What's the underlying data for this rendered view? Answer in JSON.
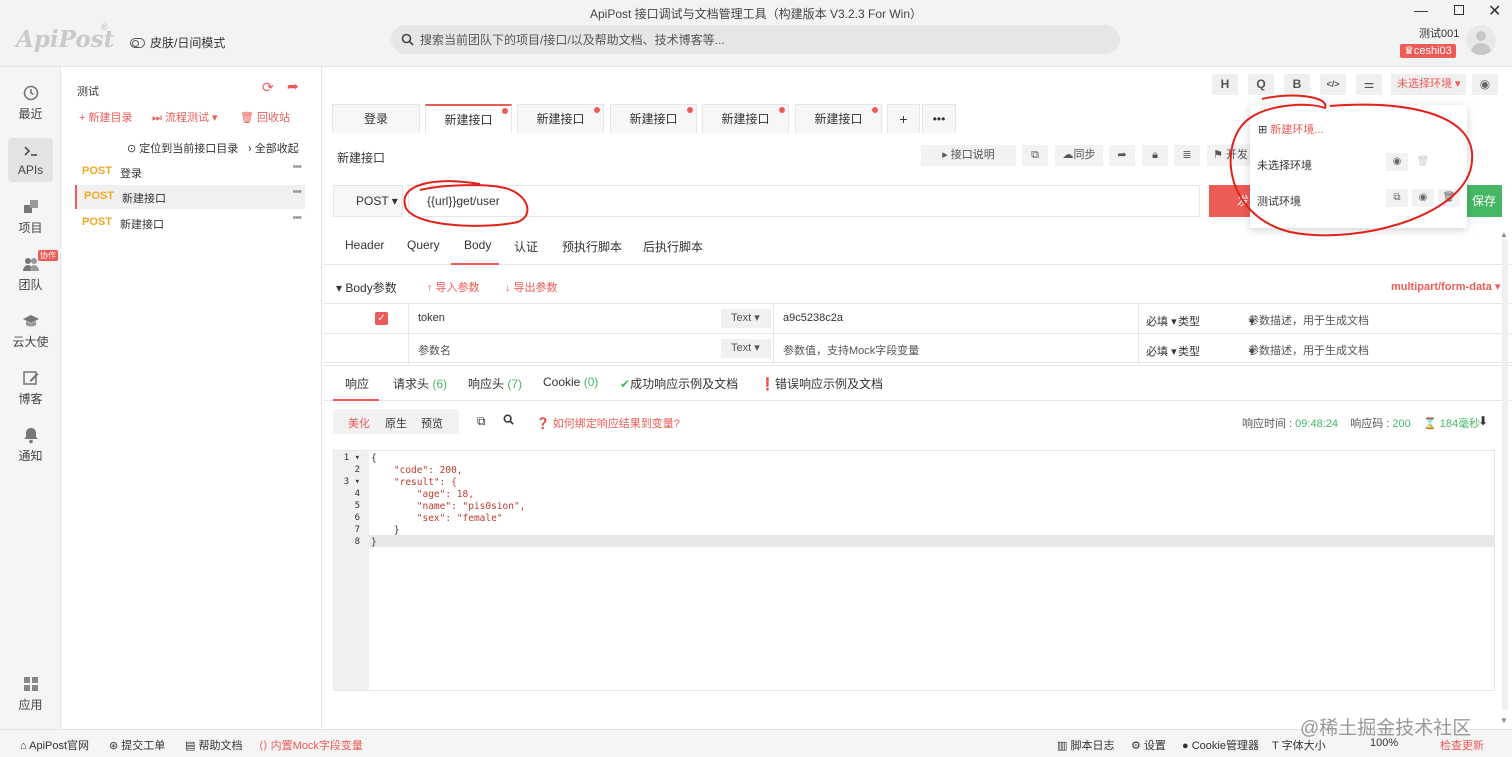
{
  "window": {
    "title": "ApiPost 接口调试与文档管理工具（构建版本 V3.2.3 For Win）",
    "logo": "ApiPost",
    "logo_mark": "®",
    "skin_mode": "皮肤/日间模式",
    "search_placeholder": "搜索当前团队下的项目/接口/以及帮助文档、技术博客等...",
    "user_name": "测试001",
    "user_badge": "ceshi03",
    "minimize": "—",
    "close": "✕"
  },
  "nav": [
    {
      "label": "最近",
      "icon": "clock-icon"
    },
    {
      "label": "APIs",
      "icon": "terminal-icon"
    },
    {
      "label": "项目",
      "icon": "project-icon"
    },
    {
      "label": "团队",
      "icon": "team-icon"
    },
    {
      "label": "云大使",
      "icon": "graduation-cap-icon"
    },
    {
      "label": "博客",
      "icon": "edit-icon"
    },
    {
      "label": "通知",
      "icon": "bell-icon"
    },
    {
      "label": "应用",
      "icon": "grid-icon"
    }
  ],
  "team_badge": "协作",
  "tree": {
    "project": "测试",
    "new_folder": "+ 新建目录",
    "flow_test": "⏭ 流程测试 ▾",
    "recycle": "🗑 回收站",
    "locate": "定位到当前接口目录",
    "collapse": "› 全部收起",
    "apis": [
      {
        "method": "POST",
        "name": "登录"
      },
      {
        "method": "POST",
        "name": "新建接口"
      },
      {
        "method": "POST",
        "name": "新建接口"
      }
    ],
    "more": "•••"
  },
  "toolbar": {
    "h": "H",
    "q": "Q",
    "b": "B",
    "code": "</>",
    "settings": "⚌",
    "env": "未选择环境 ▾",
    "eye": "◉"
  },
  "tabs": [
    {
      "label": "登录",
      "dot": false
    },
    {
      "label": "新建接口",
      "dot": true
    },
    {
      "label": "新建接口",
      "dot": true
    },
    {
      "label": "新建接口",
      "dot": true
    },
    {
      "label": "新建接口",
      "dot": true
    },
    {
      "label": "新建接口",
      "dot": true
    }
  ],
  "tab_add": "+",
  "tab_more": "•••",
  "api": {
    "title": "新建接口",
    "doc_btn": "▸ 接口说明",
    "sync_btn": "同步",
    "dev_btn": "开发",
    "method": "POST ▾",
    "url": "{{url}}get/user",
    "send": "发送",
    "save": "保存"
  },
  "req_tabs": [
    "Header",
    "Query",
    "Body",
    "认证",
    "预执行脚本",
    "后执行脚本"
  ],
  "body": {
    "label": "▾ Body参数",
    "import": "↑ 导入参数",
    "export": "↓ 导出参数",
    "content_type": "multipart/form-data ▾",
    "rows": [
      {
        "key": "token",
        "type": "Text ▾",
        "value": "a9c5238c2a",
        "required": "必填",
        "kind": "类型",
        "desc": "参数描述，用于生成文档",
        "checked": true
      },
      {
        "key": "参数名",
        "type": "Text ▾",
        "value": "参数值，支持Mock字段变量",
        "required": "必填",
        "kind": "类型",
        "desc": "参数描述，用于生成文档",
        "checked": false
      }
    ],
    "caret": "▾"
  },
  "resp_tabs": {
    "response": "响应",
    "req_header": "请求头",
    "req_header_count": "(6)",
    "resp_header": "响应头",
    "resp_header_count": "(7)",
    "cookie": "Cookie",
    "cookie_count": "(0)",
    "success_doc": "成功响应示例及文档",
    "error_doc": "错误响应示例及文档"
  },
  "resp_view": {
    "pretty": "美化",
    "raw": "原生",
    "preview": "预览",
    "bind_help": "如何绑定响应结果到变量?",
    "time_label": "响应时间 : ",
    "time": "09:48:24",
    "code_label": "响应码 : ",
    "code": "200",
    "size": "184毫秒"
  },
  "code_lines": [
    "{",
    "    \"code\": 200,",
    "    \"result\": {",
    "        \"age\": 18,",
    "        \"name\": \"pis0sion\",",
    "        \"sex\": \"female\"",
    "    }",
    "}"
  ],
  "line_numbers": [
    "1 ▾",
    "2",
    "3 ▾",
    "4",
    "5",
    "6",
    "7",
    "8"
  ],
  "env_dropdown": {
    "new_env": "新建环境...",
    "items": [
      "未选择环境",
      "测试环境"
    ]
  },
  "footer": {
    "official": "ApiPost官网",
    "ticket": "提交工单",
    "help": "帮助文档",
    "mock": "内置Mock字段变量",
    "script_log": "脚本日志",
    "settings": "设置",
    "cookie_mgr": "Cookie管理器",
    "font_size": "字体大小",
    "zoom": "100%",
    "check_update": "检查更新"
  },
  "watermark": "@稀土掘金技术社区",
  "colors": {
    "accent": "#ec5b56",
    "method": "#f5a623",
    "success": "#46b864",
    "annotation": "#e0221b"
  }
}
